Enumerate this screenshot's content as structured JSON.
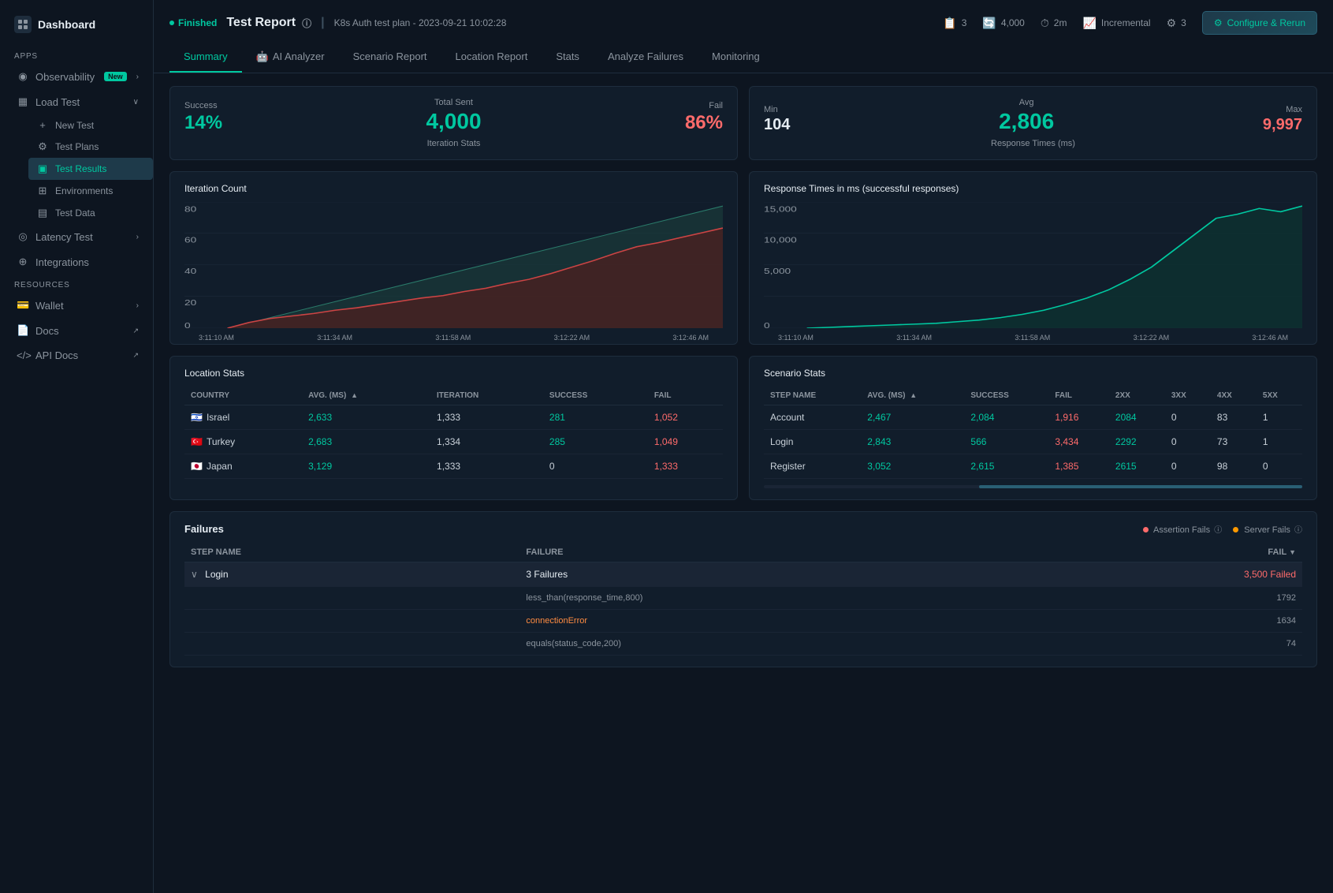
{
  "sidebar": {
    "logo": "Dashboard",
    "sections": {
      "apps": "APPS",
      "resources": "RESOURCES"
    },
    "items": {
      "dashboard": "Dashboard",
      "observability": "Observability",
      "observability_badge": "New",
      "load_test": "Load Test",
      "new_test": "New Test",
      "test_plans": "Test Plans",
      "test_results": "Test Results",
      "environments": "Environments",
      "test_data": "Test Data",
      "latency_test": "Latency Test",
      "integrations": "Integrations",
      "wallet": "Wallet",
      "docs": "Docs",
      "api_docs": "API Docs"
    }
  },
  "header": {
    "title": "Test Report",
    "separator": "|",
    "subtitle": "K8s Auth test plan - 2023-09-21 10:02:28",
    "status": "Finished",
    "configure_btn": "Configure & Rerun",
    "meta": [
      {
        "icon": "📋",
        "value": "3"
      },
      {
        "icon": "🔄",
        "value": "4,000"
      },
      {
        "icon": "⏱",
        "value": "2m"
      },
      {
        "icon": "📈",
        "value": "Incremental"
      },
      {
        "icon": "⚙",
        "value": "3"
      }
    ]
  },
  "tabs": [
    {
      "label": "Summary",
      "active": true,
      "icon": ""
    },
    {
      "label": "AI Analyzer",
      "active": false,
      "icon": "🤖"
    },
    {
      "label": "Scenario Report",
      "active": false,
      "icon": ""
    },
    {
      "label": "Location Report",
      "active": false,
      "icon": ""
    },
    {
      "label": "Stats",
      "active": false,
      "icon": ""
    },
    {
      "label": "Analyze Failures",
      "active": false,
      "icon": ""
    },
    {
      "label": "Monitoring",
      "active": false,
      "icon": ""
    }
  ],
  "iteration_stats": {
    "title": "Iteration Stats",
    "success_label": "Success",
    "success_value": "14%",
    "total_sent_label": "Total Sent",
    "total_sent_value": "4,000",
    "fail_label": "Fail",
    "fail_value": "86%"
  },
  "response_times": {
    "title": "Response Times (ms)",
    "min_label": "Min",
    "min_value": "104",
    "avg_label": "Avg",
    "avg_value": "2,806",
    "max_label": "Max",
    "max_value": "9,997"
  },
  "iteration_count_chart": {
    "title": "Iteration Count",
    "times": [
      "3:11:10 AM",
      "3:11:34 AM",
      "3:11:58 AM",
      "3:12:22 AM",
      "3:12:46 AM"
    ],
    "y_labels": [
      "0",
      "20",
      "40",
      "60",
      "80"
    ]
  },
  "response_times_chart": {
    "title": "Response Times in ms (successful responses)",
    "times": [
      "3:11:10 AM",
      "3:11:34 AM",
      "3:11:58 AM",
      "3:12:22 AM",
      "3:12:46 AM"
    ],
    "y_labels": [
      "0",
      "5,000",
      "10,000",
      "15,000"
    ]
  },
  "location_stats": {
    "title": "Location Stats",
    "columns": [
      "COUNTRY",
      "AVG. (MS)",
      "ITERATION",
      "SUCCESS",
      "FAIL"
    ],
    "rows": [
      {
        "country": "Israel",
        "flag": "🇮🇱",
        "avg": "2,633",
        "iteration": "1,333",
        "success": "281",
        "fail": "1,052"
      },
      {
        "country": "Turkey",
        "flag": "🇹🇷",
        "avg": "2,683",
        "iteration": "1,334",
        "success": "285",
        "fail": "1,049"
      },
      {
        "country": "Japan",
        "flag": "🇯🇵",
        "avg": "3,129",
        "iteration": "1,333",
        "success": "0",
        "fail": "1,333"
      }
    ]
  },
  "scenario_stats": {
    "title": "Scenario Stats",
    "columns": [
      "STEP NAME",
      "AVG. (MS)",
      "SUCCESS",
      "FAIL",
      "2XX",
      "3XX",
      "4XX",
      "5XX"
    ],
    "rows": [
      {
        "step": "Account",
        "avg": "2,467",
        "success": "2,084",
        "fail": "1,916",
        "xx2": "2084",
        "xx3": "0",
        "xx4": "83",
        "xx5": "1"
      },
      {
        "step": "Login",
        "avg": "2,843",
        "success": "566",
        "fail": "3,434",
        "xx2": "2292",
        "xx3": "0",
        "xx4": "73",
        "xx5": "1"
      },
      {
        "step": "Register",
        "avg": "3,052",
        "success": "2,615",
        "fail": "1,385",
        "xx2": "2615",
        "xx3": "0",
        "xx4": "98",
        "xx5": "0"
      }
    ]
  },
  "failures": {
    "title": "Failures",
    "legend": {
      "assertion": "Assertion Fails",
      "server": "Server Fails"
    },
    "columns": [
      "Step Name",
      "Failure",
      "Fail"
    ],
    "rows": [
      {
        "step": "Login",
        "type": "group",
        "summary": "3 Failures",
        "fail_count": "3,500 Failed",
        "details": [
          {
            "name": "less_than(response_time,800)",
            "is_link": false,
            "fail": "1792"
          },
          {
            "name": "connectionError",
            "is_link": true,
            "fail": "1634"
          },
          {
            "name": "equals(status_code,200)",
            "is_link": false,
            "fail": "74"
          }
        ]
      }
    ]
  }
}
